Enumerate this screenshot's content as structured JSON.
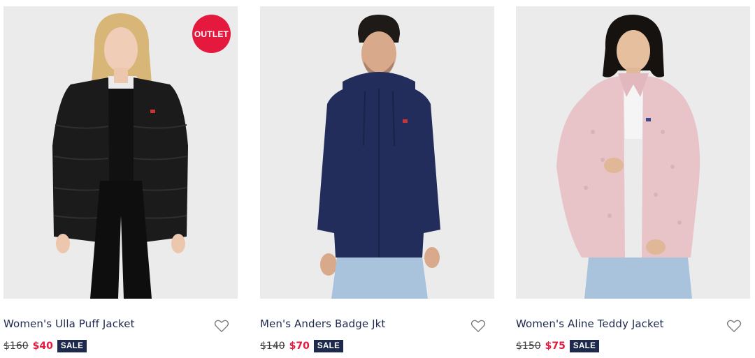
{
  "products": [
    {
      "name": "Women's Ulla Puff Jacket",
      "old_price": "$160",
      "new_price": "$40",
      "sale_label": "SALE",
      "badge": "OUTLET",
      "garment_color": "#1a1a1a",
      "wishlist_icon": "heart-outline-icon"
    },
    {
      "name": "Men's Anders Badge Jkt",
      "old_price": "$140",
      "new_price": "$70",
      "sale_label": "SALE",
      "garment_color": "#232d5c",
      "wishlist_icon": "heart-outline-icon"
    },
    {
      "name": "Women's Aline Teddy Jacket",
      "old_price": "$150",
      "new_price": "$75",
      "sale_label": "SALE",
      "garment_color": "#e8c3c8",
      "wishlist_icon": "heart-outline-icon"
    }
  ],
  "colors": {
    "sale_red": "#e4193d",
    "navy": "#1d2a4d",
    "image_bg": "#ebebeb"
  }
}
